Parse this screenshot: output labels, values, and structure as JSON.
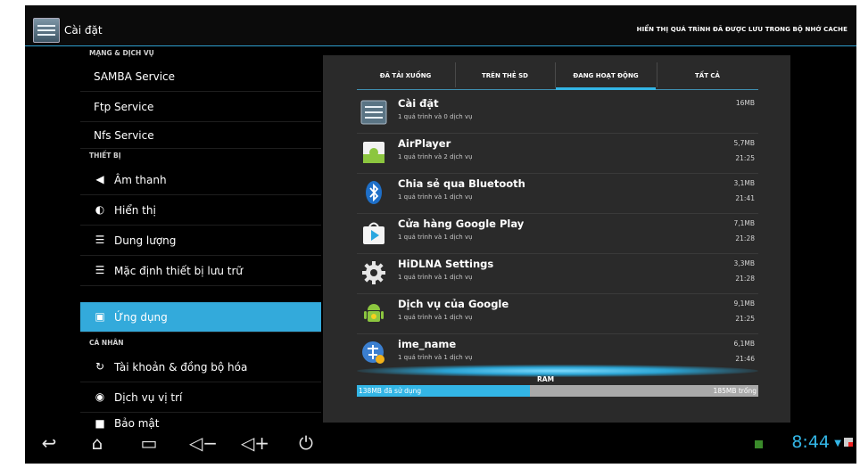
{
  "topbar": {
    "title": "Cài đặt",
    "menu_hint": "HIỂN THỊ QUÁ TRÌNH ĐÃ ĐƯỢC LƯU TRONG BỘ NHỚ CACHE"
  },
  "sidebar": {
    "sections": [
      "MẠNG & DỊCH VỤ",
      "THIẾT BỊ",
      "CÁ NHÂN"
    ],
    "items": [
      {
        "label": "SAMBA Service",
        "icon": ""
      },
      {
        "label": "Ftp Service",
        "icon": ""
      },
      {
        "label": "Nfs Service",
        "icon": ""
      },
      {
        "label": "Âm thanh",
        "icon": "speaker-icon"
      },
      {
        "label": "Hiển thị",
        "icon": "display-icon"
      },
      {
        "label": "Dung lượng",
        "icon": "storage-icon"
      },
      {
        "label": "Mặc định thiết bị lưu trữ",
        "icon": "storage-icon"
      },
      {
        "label": "Ứng dụng",
        "icon": "apps-icon"
      },
      {
        "label": "Tài khoản & đồng bộ hóa",
        "icon": "sync-icon"
      },
      {
        "label": "Dịch vụ vị trí",
        "icon": "location-icon"
      },
      {
        "label": "Bảo mật",
        "icon": "lock-icon"
      }
    ],
    "selected_index": 7
  },
  "tabs": [
    "ĐÃ TẢI XUỐNG",
    "TRÊN THẺ SD",
    "ĐANG HOẠT ĐỘNG",
    "TẤT CẢ"
  ],
  "active_tab": 2,
  "processes": [
    {
      "name": "Cài đặt",
      "sub": "1 quá trình và 0 dịch vụ",
      "size": "16MB",
      "time": "",
      "icon": "settings-app-icon"
    },
    {
      "name": "AirPlayer",
      "sub": "1 quá trình và 2 dịch vụ",
      "size": "5,7MB",
      "time": "21:25",
      "icon": "airplayer-icon"
    },
    {
      "name": "Chia sẻ qua Bluetooth",
      "sub": "1 quá trình và 1 dịch vụ",
      "size": "3,1MB",
      "time": "21:41",
      "icon": "bluetooth-icon"
    },
    {
      "name": "Cửa hàng Google Play",
      "sub": "1 quá trình và 1 dịch vụ",
      "size": "7,1MB",
      "time": "21:28",
      "icon": "google-play-icon"
    },
    {
      "name": "HiDLNA Settings",
      "sub": "1 quá trình và 1 dịch vụ",
      "size": "3,3MB",
      "time": "21:28",
      "icon": "gear-icon"
    },
    {
      "name": "Dịch vụ của Google",
      "sub": "1 quá trình và 1 dịch vụ",
      "size": "9,1MB",
      "time": "21:25",
      "icon": "android-icon"
    },
    {
      "name": "ime_name",
      "sub": "1 quá trình và 1 dịch vụ",
      "size": "6,1MB",
      "time": "21:46",
      "icon": "ime-icon"
    }
  ],
  "ram": {
    "label": "RAM",
    "used_label": "138MB đã sử dụng",
    "free_label": "185MB trống",
    "used_fraction": 0.43
  },
  "statusbar": {
    "time": "8:44"
  },
  "colors": {
    "accent": "#33b5e5",
    "background": "#000000",
    "panel": "#2a2a2a"
  }
}
